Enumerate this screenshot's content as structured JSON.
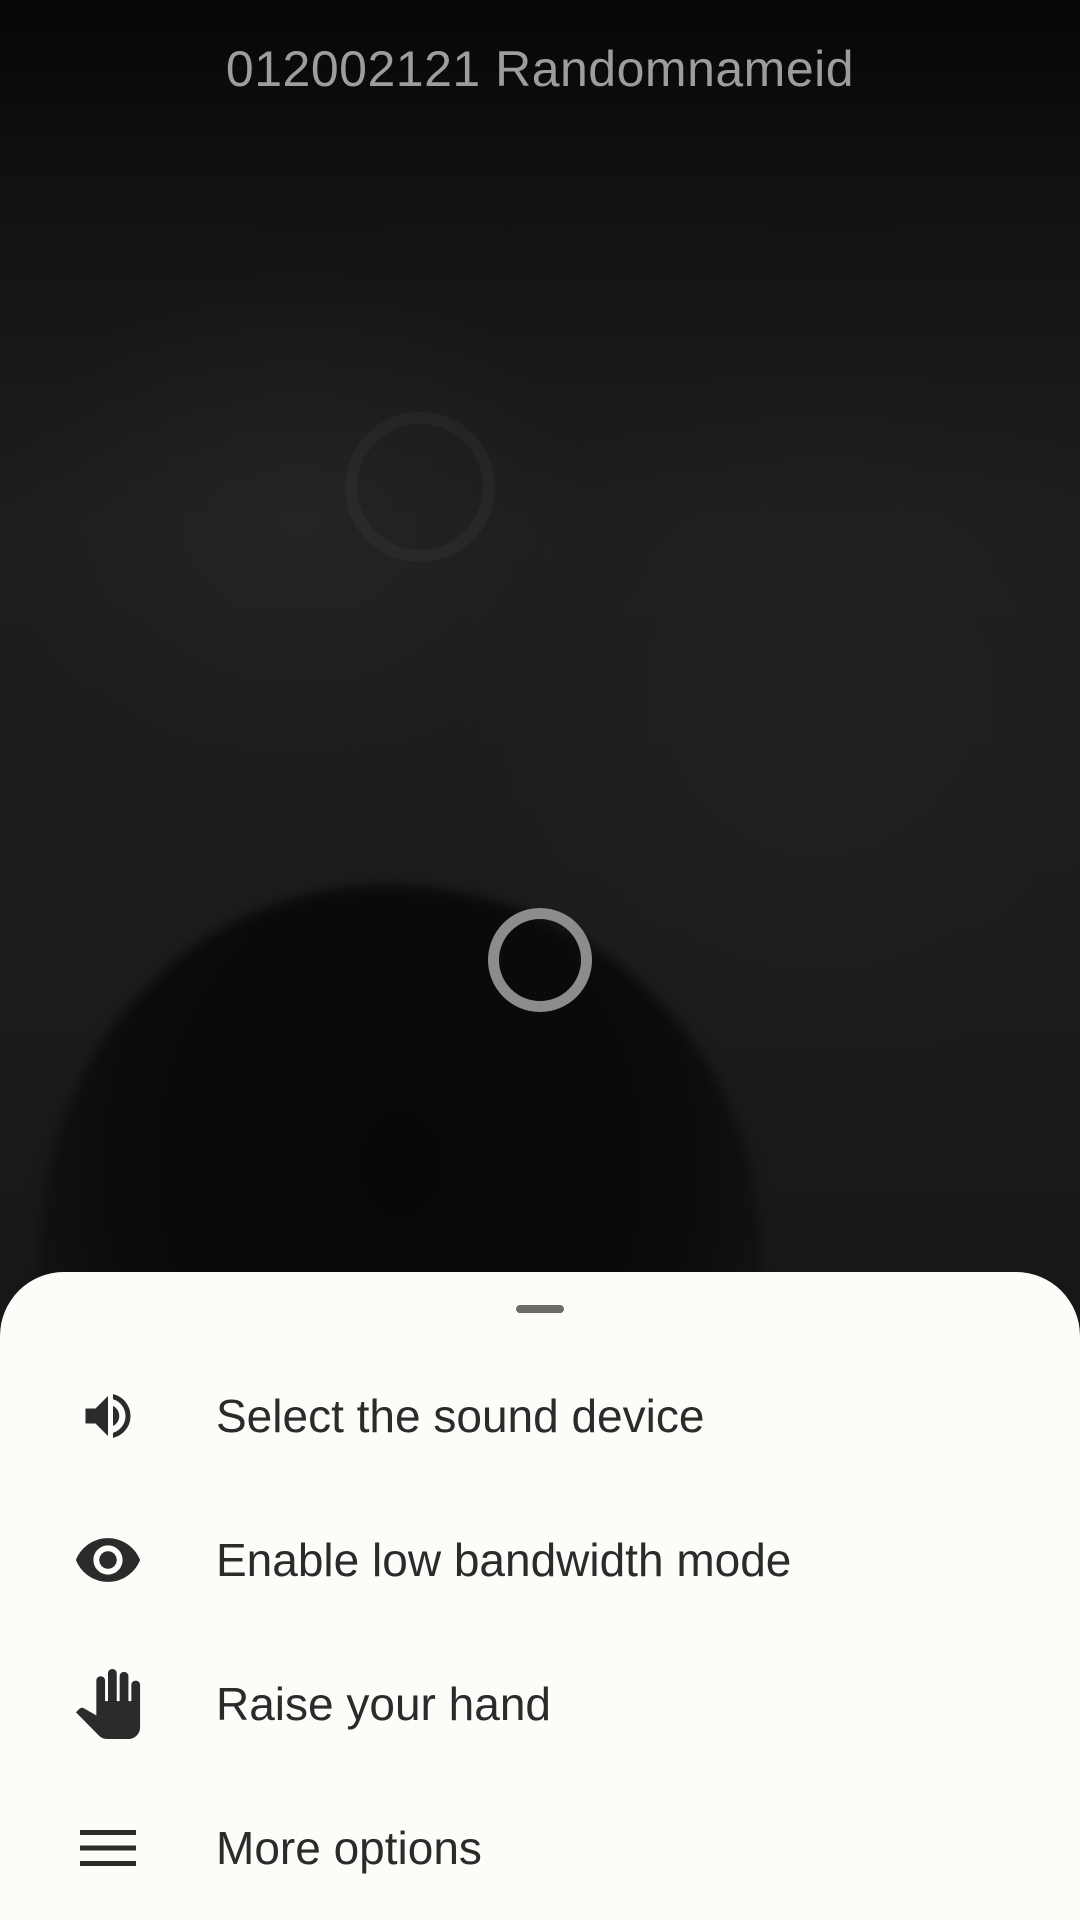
{
  "call": {
    "title": "012002121 Randomnameid"
  },
  "menu": {
    "items": [
      {
        "label": "Select the sound device",
        "icon": "volume-icon"
      },
      {
        "label": "Enable low bandwidth mode",
        "icon": "eye-icon"
      },
      {
        "label": "Raise your hand",
        "icon": "hand-icon"
      },
      {
        "label": "More options",
        "icon": "menu-icon"
      }
    ]
  },
  "colors": {
    "sheet_background": "#fbfdf9",
    "text": "#2a2b2a",
    "title_text": "#9c9e9c",
    "video_background": "#1b1c1b"
  }
}
